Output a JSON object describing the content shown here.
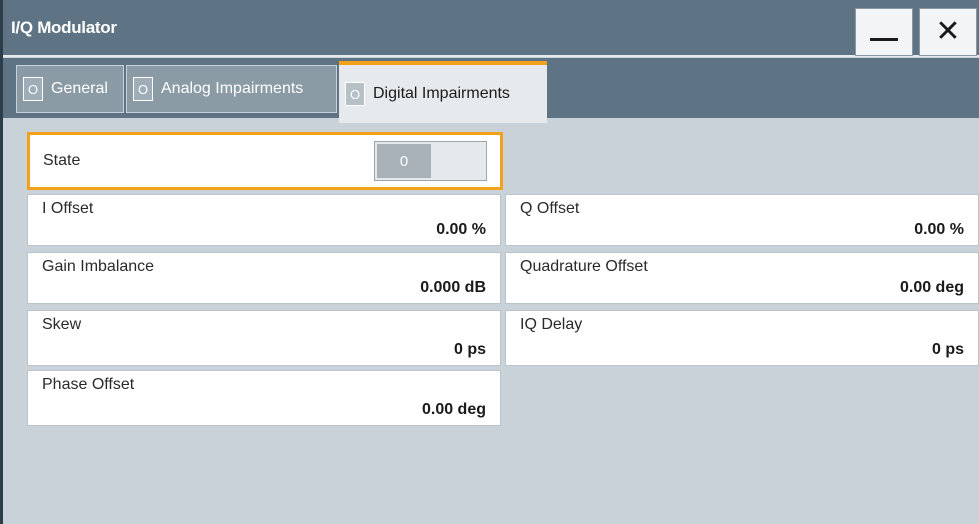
{
  "window": {
    "title": "I/Q Modulator",
    "minimize_icon": "minimize-icon",
    "close_icon": "close-icon",
    "accent_color": "#f3a11b"
  },
  "tabs": [
    {
      "radio": "O",
      "label": "General",
      "active": false
    },
    {
      "radio": "O",
      "label": "Analog Impairments",
      "active": false
    },
    {
      "radio": "O",
      "label": "Digital Impairments",
      "active": true
    }
  ],
  "state": {
    "label": "State",
    "toggle_value": "0"
  },
  "fields": {
    "i_offset": {
      "label": "I Offset",
      "value": "0.00 %"
    },
    "q_offset": {
      "label": "Q Offset",
      "value": "0.00 %"
    },
    "gain_imbalance": {
      "label": "Gain Imbalance",
      "value": "0.000 dB"
    },
    "quadrature_offset": {
      "label": "Quadrature Offset",
      "value": "0.00 deg"
    },
    "skew": {
      "label": "Skew",
      "value": "0 ps"
    },
    "iq_delay": {
      "label": "IQ Delay",
      "value": "0 ps"
    },
    "phase_offset": {
      "label": "Phase Offset",
      "value": "0.00 deg"
    }
  }
}
